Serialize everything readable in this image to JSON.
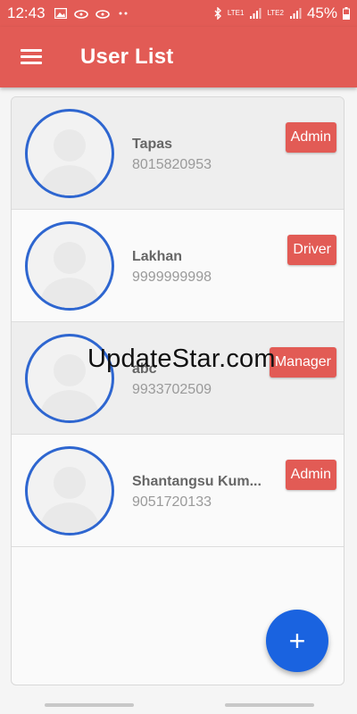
{
  "status_bar": {
    "time": "12:43",
    "battery": "45%",
    "network_1": "LTE1",
    "network_2": "LTE2",
    "left_icons": [
      "image-icon",
      "cloud-icon",
      "cloud-icon",
      "dots-icon"
    ],
    "right_icons": [
      "bluetooth-icon",
      "signal-icon",
      "signal-icon",
      "battery-icon"
    ]
  },
  "app_bar": {
    "title": "User List",
    "menu_icon": "hamburger-menu-icon"
  },
  "users": [
    {
      "name": "Tapas",
      "phone": "8015820953",
      "role": "Admin"
    },
    {
      "name": "Lakhan",
      "phone": "9999999998",
      "role": "Driver"
    },
    {
      "name": "abc",
      "phone": "9933702509",
      "role": "Manager"
    },
    {
      "name": "Shantangsu Kum...",
      "phone": "9051720133",
      "role": "Admin"
    }
  ],
  "fab": {
    "label": "+",
    "icon": "plus-icon"
  },
  "watermark": "UpdateStar.com",
  "colors": {
    "primary": "#e25b55",
    "accent": "#1a63e0",
    "avatar_ring": "#2e66d0"
  }
}
